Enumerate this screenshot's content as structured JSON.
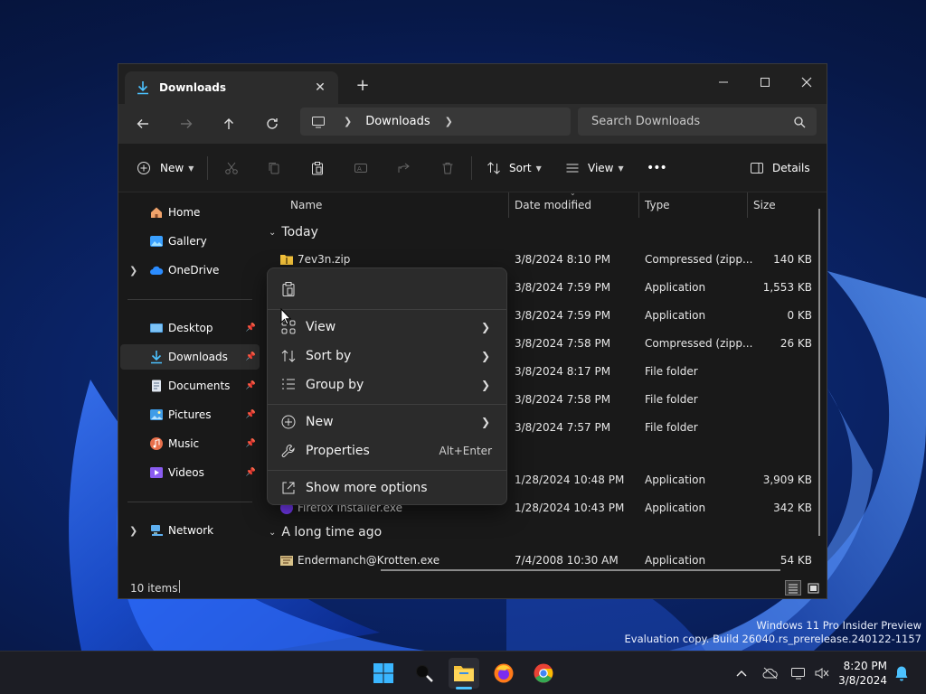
{
  "window": {
    "tab_title": "Downloads",
    "new_tab": "+",
    "address": {
      "crumbs": [
        "Downloads"
      ]
    },
    "search_placeholder": "Search Downloads"
  },
  "command_bar": {
    "new_label": "New",
    "sort_label": "Sort",
    "view_label": "View",
    "more_label": "•••",
    "details_label": "Details"
  },
  "sidebar": {
    "items": [
      {
        "label": "Home",
        "icon": "home-icon"
      },
      {
        "label": "Gallery",
        "icon": "gallery-icon"
      },
      {
        "label": "OneDrive",
        "icon": "cloud-icon"
      },
      {
        "label": "Desktop",
        "icon": "desktop-icon"
      },
      {
        "label": "Downloads",
        "icon": "download-icon"
      },
      {
        "label": "Documents",
        "icon": "documents-icon"
      },
      {
        "label": "Pictures",
        "icon": "pictures-icon"
      },
      {
        "label": "Music",
        "icon": "music-icon"
      },
      {
        "label": "Videos",
        "icon": "videos-icon"
      },
      {
        "label": "Network",
        "icon": "network-icon"
      }
    ]
  },
  "columns": {
    "name": "Name",
    "date": "Date modified",
    "type": "Type",
    "size": "Size"
  },
  "groups": {
    "today": "Today",
    "long_ago": "A long time ago"
  },
  "files": [
    {
      "name": "7ev3n.zip",
      "date": "3/8/2024 8:10 PM",
      "type": "Compressed (zipp...",
      "size": "140 KB"
    },
    {
      "name": "",
      "date": "3/8/2024 7:59 PM",
      "type": "Application",
      "size": "1,553 KB"
    },
    {
      "name": "",
      "date": "3/8/2024 7:59 PM",
      "type": "Application",
      "size": "0 KB"
    },
    {
      "name": "",
      "date": "3/8/2024 7:58 PM",
      "type": "Compressed (zipp...",
      "size": "26 KB"
    },
    {
      "name": "",
      "date": "3/8/2024 8:17 PM",
      "type": "File folder",
      "size": ""
    },
    {
      "name": "",
      "date": "3/8/2024 7:58 PM",
      "type": "File folder",
      "size": ""
    },
    {
      "name": "",
      "date": "3/8/2024 7:57 PM",
      "type": "File folder",
      "size": ""
    },
    {
      "name": "",
      "date": "1/28/2024 10:48 PM",
      "type": "Application",
      "size": "3,909 KB"
    },
    {
      "name": "Firefox Installer.exe",
      "date": "1/28/2024 10:43 PM",
      "type": "Application",
      "size": "342 KB"
    },
    {
      "name": "Endermanch@Krotten.exe",
      "date": "7/4/2008 10:30 AM",
      "type": "Application",
      "size": "54 KB"
    }
  ],
  "status": {
    "count": "10 items"
  },
  "context_menu": {
    "view": "View",
    "sort_by": "Sort by",
    "group_by": "Group by",
    "new": "New",
    "properties": "Properties",
    "properties_shortcut": "Alt+Enter",
    "more_options": "Show more options"
  },
  "desktop": {
    "watermark_line1": "Windows 11 Pro Insider Preview",
    "watermark_line2": "Evaluation copy. Build 26040.rs_prerelease.240122-1157"
  },
  "taskbar": {
    "time": "8:20 PM",
    "date": "3/8/2024"
  },
  "colors": {
    "accent": "#4cc2ff",
    "folder": "#f5c33b",
    "window_bg": "#191919"
  }
}
